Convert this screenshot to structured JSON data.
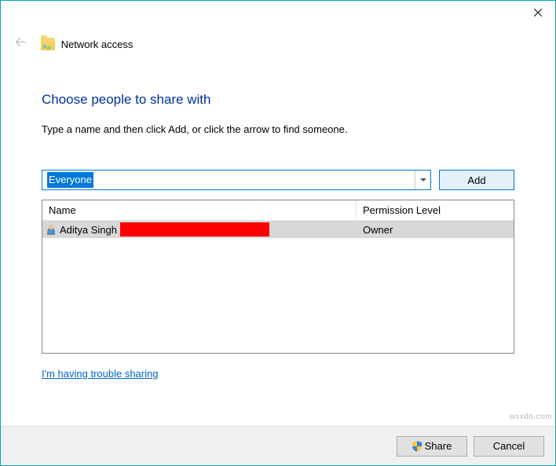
{
  "window": {
    "title": "Network access"
  },
  "heading": "Choose people to share with",
  "instruction": "Type a name and then click Add, or click the arrow to find someone.",
  "input": {
    "value": "Everyone"
  },
  "buttons": {
    "add": "Add",
    "share": "Share",
    "cancel": "Cancel"
  },
  "table": {
    "headers": {
      "name": "Name",
      "permission": "Permission Level"
    },
    "rows": [
      {
        "name": "Aditya Singh",
        "permission": "Owner"
      }
    ]
  },
  "help_link": "I'm having trouble sharing",
  "watermark": "wsxdn.com"
}
